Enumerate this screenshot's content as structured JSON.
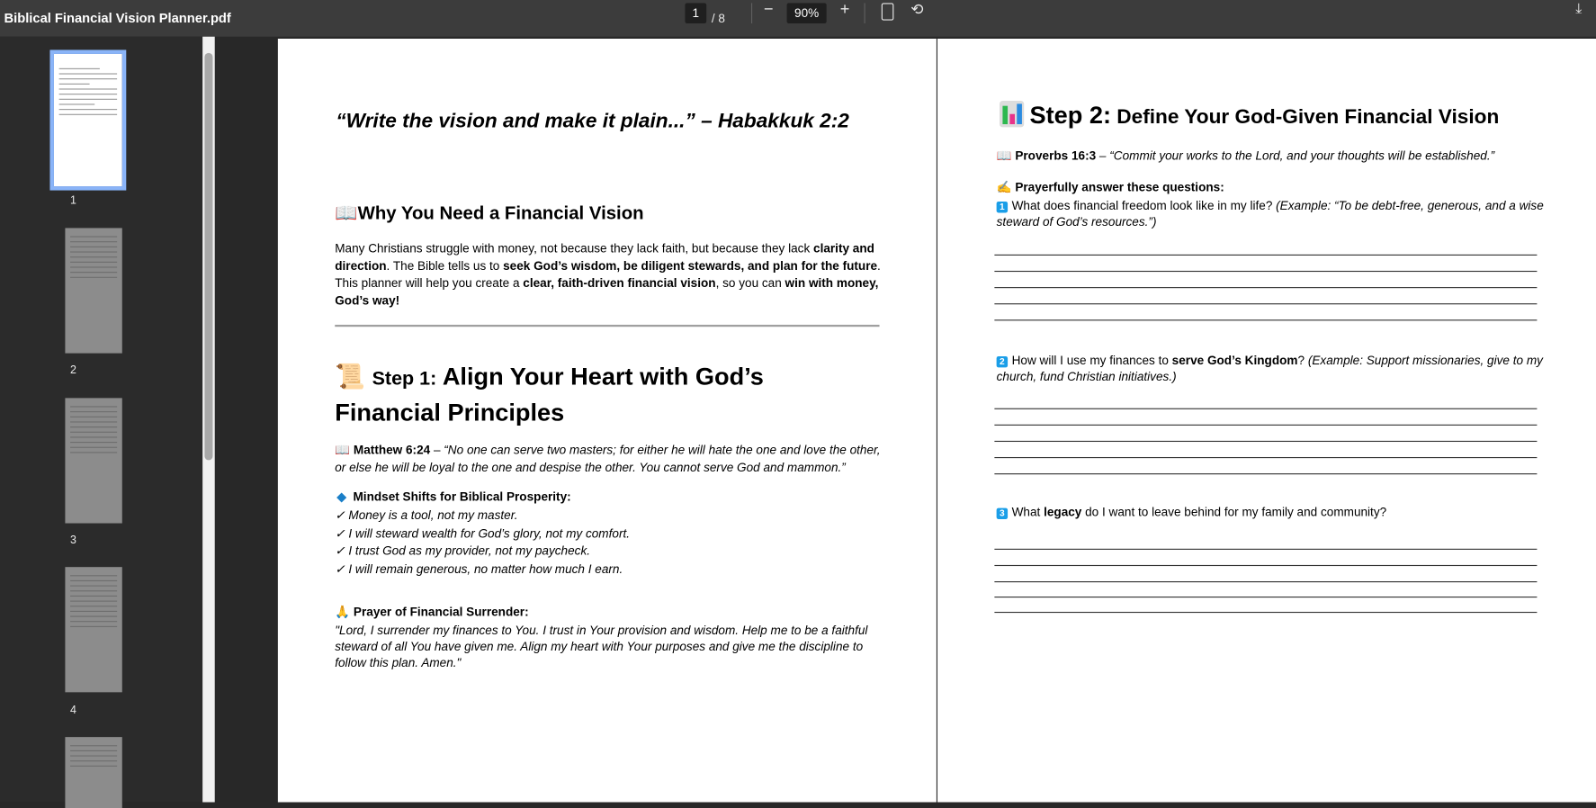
{
  "toolbar": {
    "title": "Biblical Financial Vision Planner.pdf",
    "current_page": "1",
    "total_pages": "/ 8",
    "zoom": "90%",
    "zoom_out": "−",
    "zoom_in": "+"
  },
  "sidebar": {
    "thumbnails": [
      {
        "label": "1"
      },
      {
        "label": "2"
      },
      {
        "label": "3"
      },
      {
        "label": "4"
      }
    ]
  },
  "left_page": {
    "quote": "“Write the vision and make it plain...” – Habakkuk 2:2",
    "why_heading": "Why You Need a Financial Vision",
    "why_para": [
      "Many Christians struggle with money, not because they lack faith, but because they lack ",
      "clarity and",
      "direction",
      ". The Bible tells us to ",
      "seek God’s wisdom, be diligent stewards, and plan for the future",
      ".",
      "This planner will help you create a ",
      "clear, faith-driven financial vision",
      ", so you can ",
      "win with money,",
      "God’s way!"
    ],
    "step1_prefix": "Step 1:",
    "step1_line1": "Align Your Heart with God’s",
    "step1_line2": "Financial Principles",
    "matthew_ref": "Matthew 6:24",
    "matthew_dash": " – ",
    "matthew_text1": "“No one can serve two masters; for either he will hate the one and love the other,",
    "matthew_text2": "or else he will be loyal to the one and despise the other. You cannot serve God and mammon.”",
    "mindset_heading": "Mindset Shifts for Biblical Prosperity:",
    "mindset_items": [
      "✓ Money is a tool, not my master.",
      "✓ I will steward wealth for God’s glory, not my comfort.",
      "✓ I trust God as my provider, not my paycheck.",
      "✓ I will remain generous, no matter how much I earn."
    ],
    "prayer_heading": "Prayer of Financial Surrender:",
    "prayer_lines": [
      "\"Lord, I surrender my finances to You. I trust in Your provision and wisdom. Help me to be a faithful",
      "steward of all You have given me. Align my heart with Your purposes and give me the discipline to",
      "follow this plan. Amen.\""
    ]
  },
  "right_page": {
    "step2_prefix": "Step 2:",
    "step2_title": "Define Your God-Given Financial Vision",
    "proverbs_ref": "Proverbs 16:3",
    "proverbs_text": " – “Commit your works to the Lord, and your thoughts will be established.”",
    "prayerfully": "Prayerfully answer these questions:",
    "q1": {
      "num": "1",
      "text": "What does financial freedom look like in my life? ",
      "example1": "(Example: “To be debt-free, generous, and a wise",
      "example2": "steward of God’s resources.”)"
    },
    "q2": {
      "num": "2",
      "text": "How will I use my finances to ",
      "bold": "serve God’s Kingdom",
      "after": "? ",
      "example1": "(Example: Support missionaries, give to my",
      "example2": "church, fund Christian initiatives.)"
    },
    "q3": {
      "num": "3",
      "pre": "What ",
      "bold": "legacy",
      "after": " do I want to leave behind for my family and community?"
    }
  }
}
